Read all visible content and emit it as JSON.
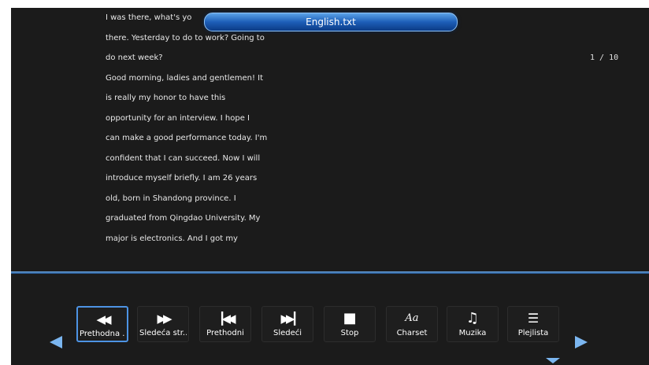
{
  "file_title": "English.txt",
  "page_indicator": "1 / 10",
  "text_lines": [
    "I was there, what's yo",
    "there. Yesterday to do to work? Going to",
    "do next week?",
    "Good morning, ladies and gentlemen! It",
    "is really my honor to have this",
    "opportunity for an interview. I hope I",
    "can make a good performance today. I'm",
    "confident that I can succeed. Now I will",
    "introduce myself briefly. I am 26 years",
    "old, born in Shandong province. I",
    "graduated from Qingdao University. My",
    "major is electronics. And I got my"
  ],
  "toolbar": {
    "buttons": [
      {
        "label": "Prethodna ...",
        "icon": "rewind-icon",
        "selected": true
      },
      {
        "label": "Sledeća str...",
        "icon": "fast-forward-icon",
        "selected": false
      },
      {
        "label": "Prethodni",
        "icon": "skip-previous-icon",
        "selected": false
      },
      {
        "label": "Sledeći",
        "icon": "skip-next-icon",
        "selected": false
      },
      {
        "label": "Stop",
        "icon": "stop-icon",
        "selected": false
      },
      {
        "label": "Charset",
        "icon": "charset-icon",
        "glyph": "Aa",
        "selected": false
      },
      {
        "label": "Muzika",
        "icon": "music-icon",
        "selected": false
      },
      {
        "label": "Plejlista",
        "icon": "playlist-icon",
        "selected": false
      }
    ]
  },
  "colors": {
    "background": "#1b1b1b",
    "accent": "#4d93e4",
    "title_bar": "#1d5eb8",
    "arrow": "#7bb6f0"
  }
}
